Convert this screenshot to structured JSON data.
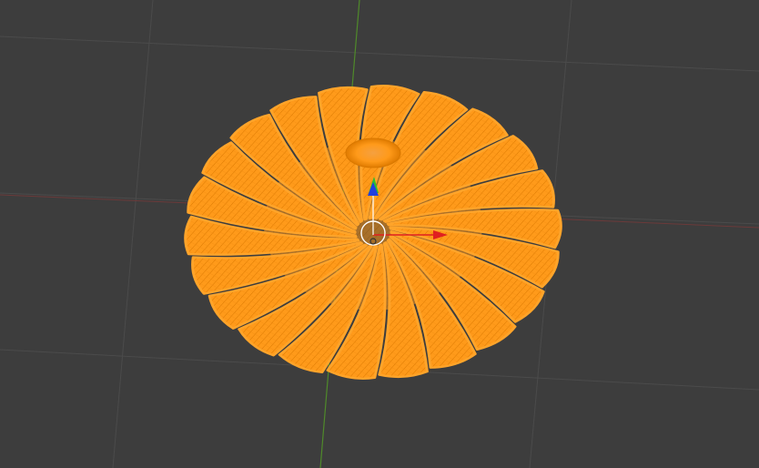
{
  "viewport": {
    "background": "#3d3d3d",
    "grid_color": "#4b4b4b",
    "x_axis_color": "#7a3a3a",
    "y_axis_color": "#5c8a2e",
    "mesh_color": "#ff9a1a",
    "mesh_shade": "#e07b00",
    "mesh_highlight": "#ffb04a"
  },
  "object": {
    "name_icon": "mesh-object-icon",
    "selected": true,
    "blade_count": 22
  },
  "gizmo": {
    "x_color": "#e02020",
    "y_color": "#2fbf2f",
    "z_color": "#2040e0",
    "center_color": "#ffffff",
    "origin_color": "#ff8000"
  }
}
